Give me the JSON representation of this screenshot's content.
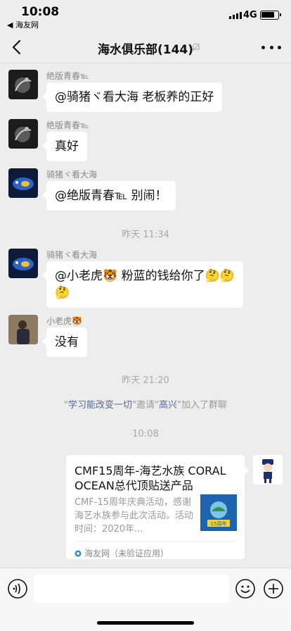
{
  "status_bar": {
    "time": "10:08",
    "back_app": "◀ 海友网",
    "network": "4G",
    "battery_level": 0.85
  },
  "header": {
    "title": "海水俱乐部(144)"
  },
  "messages": [
    {
      "sender": "绝版青春℡",
      "text": "@骑猪ヾ看大海 老板养的正好"
    },
    {
      "sender": "绝版青春℡",
      "text": "真好"
    },
    {
      "sender": "骑猪ヾ看大海",
      "text": "@绝版青春℡ 别闹！"
    },
    {
      "sender": "骑猪ヾ看大海",
      "text_line1": "@小老虎🐯 粉蓝的钱给你了🤔🤔",
      "text_line2": "🤔"
    },
    {
      "sender": "小老虎🐯",
      "text": "没有"
    }
  ],
  "timestamps": [
    "昨天 11:34",
    "昨天 21:20",
    "10:08"
  ],
  "system_notice": {
    "q1": "\"",
    "inviter": "学习能改变一切",
    "mid": "\"邀请\"",
    "invitee": "高兴",
    "tail": "\"加入了群聊"
  },
  "link_card": {
    "title": "CMF15周年-海艺水族 CORAL OCEAN总代顶贴送产品",
    "description": "CMF-15周年庆典活动，感谢海艺水族参与此次活动。活动时间：2020年...",
    "thumb_text": "15周年",
    "source": "海友网（未验证应用）"
  },
  "colors": {
    "link": "#576b95",
    "background": "#ededed",
    "bubble": "#ffffff"
  }
}
